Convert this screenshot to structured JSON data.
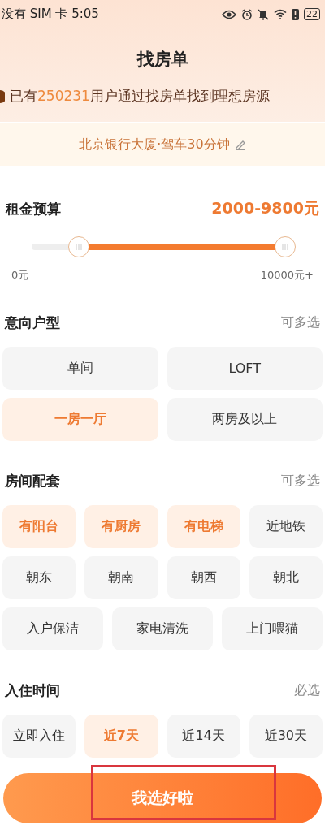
{
  "status_bar": {
    "carrier": "没有 SIM 卡 5:05",
    "battery": "22"
  },
  "title": "找房单",
  "banner": {
    "prefix": "已有",
    "count": "250231",
    "suffix": "用户通过找房单找到理想房源"
  },
  "location": "北京银行大厦·驾车30分钟",
  "budget": {
    "label": "租金预算",
    "value": "2000-9800元",
    "thumbs": [
      {
        "level": 0.15
      },
      {
        "level": 1.0
      }
    ],
    "min_label": "0元",
    "max_label": "10000元+"
  },
  "layout": {
    "label": "意向户型",
    "hint": "可多选",
    "options": [
      {
        "label": "单间",
        "selected": false
      },
      {
        "label": "LOFT",
        "selected": false
      },
      {
        "label": "一房一厅",
        "selected": true
      },
      {
        "label": "两房及以上",
        "selected": false
      }
    ]
  },
  "facilities": {
    "label": "房间配套",
    "hint": "可多选",
    "options": [
      {
        "label": "有阳台",
        "selected": true
      },
      {
        "label": "有厨房",
        "selected": true
      },
      {
        "label": "有电梯",
        "selected": true
      },
      {
        "label": "近地铁",
        "selected": false
      },
      {
        "label": "朝东",
        "selected": false
      },
      {
        "label": "朝南",
        "selected": false
      },
      {
        "label": "朝西",
        "selected": false
      },
      {
        "label": "朝北",
        "selected": false
      },
      {
        "label": "入户保洁",
        "selected": false
      },
      {
        "label": "家电清洗",
        "selected": false
      },
      {
        "label": "上门喂猫",
        "selected": false
      }
    ]
  },
  "move_in": {
    "label": "入住时间",
    "hint": "必选",
    "options": [
      {
        "label": "立即入住",
        "selected": false
      },
      {
        "label": "近7天",
        "selected": true
      },
      {
        "label": "近14天",
        "selected": false
      },
      {
        "label": "近30天",
        "selected": false
      }
    ]
  },
  "submit": {
    "label": "我选好啦",
    "highlighted": true
  }
}
